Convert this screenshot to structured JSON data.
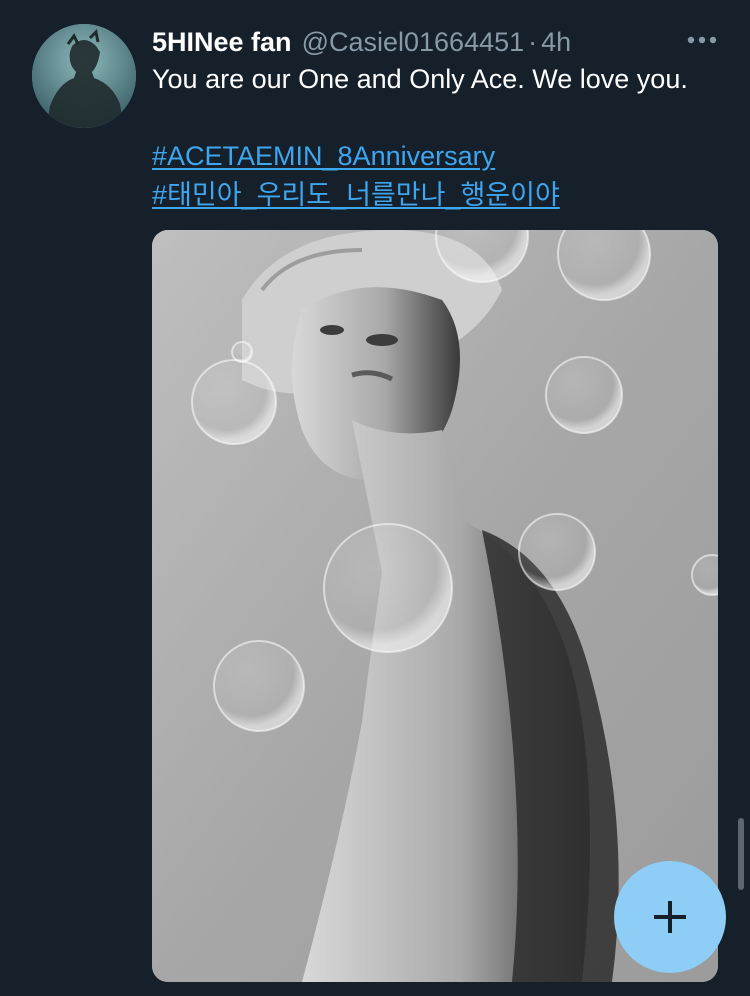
{
  "tweet": {
    "display_name": "5HINee fan",
    "handle": "@Casiel01664451",
    "separator": "·",
    "time": "4h",
    "text": "You are our One and Only Ace. We love you.",
    "hashtags": [
      "#ACETAEMIN_8Anniversary",
      "#태민아_우리도_너를만나_행운이야"
    ]
  },
  "icons": {
    "avatar": "profile-avatar",
    "more": "more-horizontal-icon",
    "compose": "plus-icon"
  },
  "colors": {
    "background": "#15202b",
    "link": "#3ea6ee",
    "secondary_text": "#8899a6",
    "fab": "#8ecdf6"
  }
}
